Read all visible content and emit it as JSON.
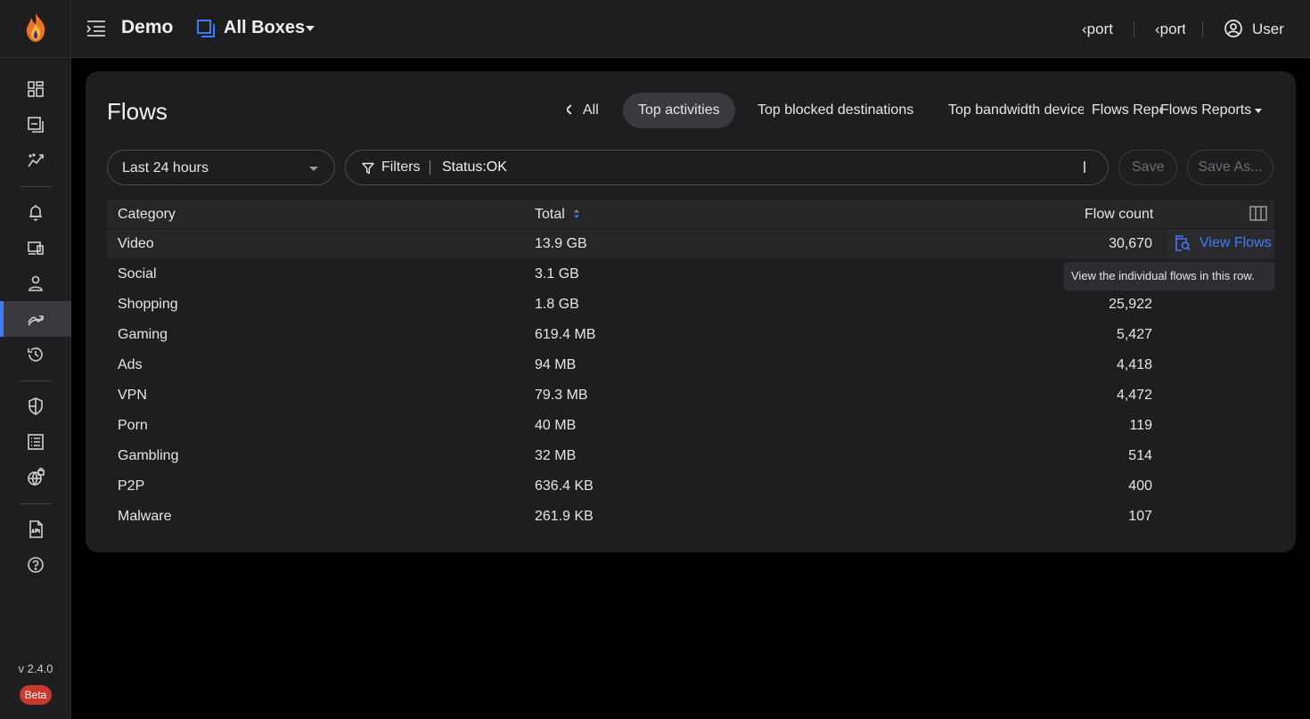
{
  "sidebar": {
    "version": "v 2.4.0",
    "beta_label": "Beta",
    "items": [
      {
        "icon": "dashboard-icon"
      },
      {
        "icon": "boxes-icon"
      },
      {
        "icon": "analytics-icon"
      },
      {
        "icon": "bell-icon"
      },
      {
        "icon": "devices-icon"
      },
      {
        "icon": "person-icon"
      },
      {
        "icon": "flows-icon",
        "active": true
      },
      {
        "icon": "history-icon"
      },
      {
        "icon": "shield-icon"
      },
      {
        "icon": "list-icon"
      },
      {
        "icon": "globe-lock-icon"
      },
      {
        "icon": "api-doc-icon"
      },
      {
        "icon": "help-icon"
      }
    ]
  },
  "topbar": {
    "title": "Demo",
    "box_selector": "All Boxes",
    "links": [
      "‹port",
      "‹port"
    ],
    "user_label": "User"
  },
  "page": {
    "title": "Flows",
    "tabs": {
      "all": "All",
      "top_activities": "Top activities",
      "top_blocked": "Top blocked destinations",
      "top_bandwidth": "Top bandwidth device",
      "flows_reports_clipped": "Flows Repo",
      "flows_reports": "Flows Reports"
    },
    "time_range": "Last 24 hours",
    "filters_label": "Filters",
    "filter_value": "Status:OK",
    "save_label": "Save",
    "save_as_label": "Save As..."
  },
  "table": {
    "headers": {
      "category": "Category",
      "total": "Total",
      "flow_count": "Flow count"
    },
    "rows": [
      {
        "category": "Video",
        "total": "13.9 GB",
        "flow_count": "30,670"
      },
      {
        "category": "Social",
        "total": "3.1 GB",
        "flow_count": ""
      },
      {
        "category": "Shopping",
        "total": "1.8 GB",
        "flow_count": "25,922"
      },
      {
        "category": "Gaming",
        "total": "619.4 MB",
        "flow_count": "5,427"
      },
      {
        "category": "Ads",
        "total": "94 MB",
        "flow_count": "4,418"
      },
      {
        "category": "VPN",
        "total": "79.3 MB",
        "flow_count": "4,472"
      },
      {
        "category": "Porn",
        "total": "40 MB",
        "flow_count": "119"
      },
      {
        "category": "Gambling",
        "total": "32 MB",
        "flow_count": "514"
      },
      {
        "category": "P2P",
        "total": "636.4 KB",
        "flow_count": "400"
      },
      {
        "category": "Malware",
        "total": "261.9 KB",
        "flow_count": "107"
      }
    ],
    "view_flows_label": "View Flows",
    "tooltip": "View the individual flows in this row."
  },
  "colors": {
    "accent": "#3f7bf5",
    "beta": "#c8382f",
    "background": "#000000",
    "panel": "#1e1e20"
  }
}
